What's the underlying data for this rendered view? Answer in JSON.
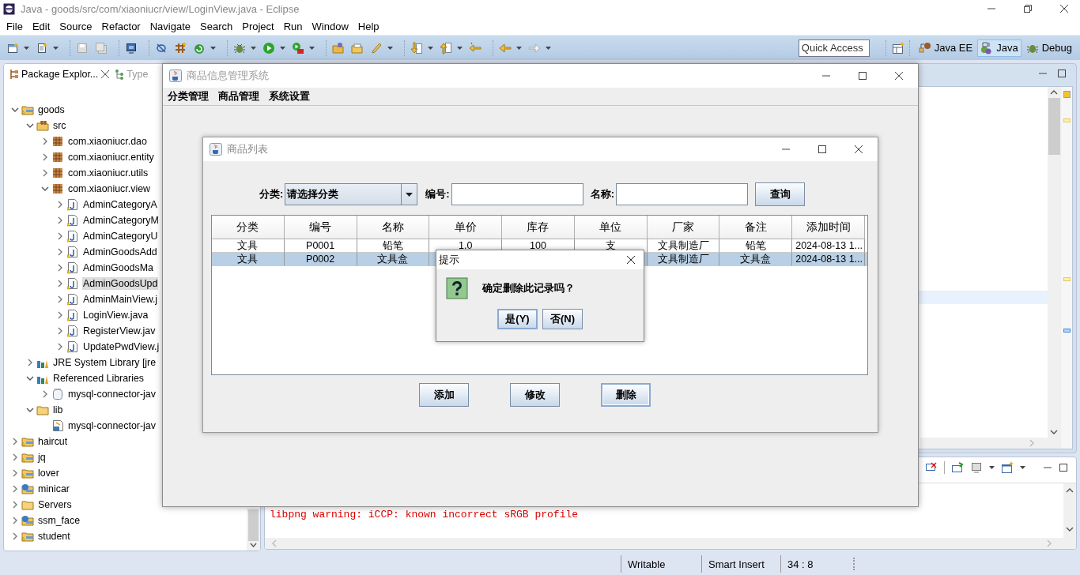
{
  "eclipse": {
    "title": "Java - goods/src/com/xiaoniucr/view/LoginView.java - Eclipse",
    "menu": [
      "File",
      "Edit",
      "Source",
      "Refactor",
      "Navigate",
      "Search",
      "Project",
      "Run",
      "Window",
      "Help"
    ],
    "quick_access": {
      "placeholder": "Quick Access"
    },
    "perspectives": [
      {
        "label": "Java EE",
        "selected": false
      },
      {
        "label": "Java",
        "selected": true
      },
      {
        "label": "Debug",
        "selected": false
      }
    ],
    "explorer": {
      "tabs": [
        {
          "label": "Package Explor...",
          "selected": true
        },
        {
          "label": "Type",
          "selected": false
        }
      ],
      "tree": [
        {
          "label": "goods",
          "kind": "project",
          "expanded": true,
          "selected": false,
          "children": [
            {
              "label": "src",
              "kind": "source",
              "expanded": true,
              "selected": false,
              "children": [
                {
                  "label": "com.xiaoniucr.dao",
                  "kind": "package",
                  "expanded": false,
                  "selected": false
                },
                {
                  "label": "com.xiaoniucr.entity",
                  "kind": "package",
                  "expanded": false,
                  "selected": false
                },
                {
                  "label": "com.xiaoniucr.utils",
                  "kind": "package",
                  "expanded": false,
                  "selected": false
                },
                {
                  "label": "com.xiaoniucr.view",
                  "kind": "package",
                  "expanded": true,
                  "selected": false,
                  "children": [
                    {
                      "label": "AdminCategoryA",
                      "kind": "java",
                      "expanded": false,
                      "selected": false
                    },
                    {
                      "label": "AdminCategoryM",
                      "kind": "java",
                      "expanded": false,
                      "selected": false
                    },
                    {
                      "label": "AdminCategoryU",
                      "kind": "java",
                      "expanded": false,
                      "selected": false
                    },
                    {
                      "label": "AdminGoodsAdd",
                      "kind": "java",
                      "expanded": false,
                      "selected": false
                    },
                    {
                      "label": "AdminGoodsMa",
                      "kind": "java",
                      "expanded": false,
                      "selected": false
                    },
                    {
                      "label": "AdminGoodsUpd",
                      "kind": "java",
                      "expanded": false,
                      "selected": true
                    },
                    {
                      "label": "AdminMainView.j",
                      "kind": "java",
                      "expanded": false,
                      "selected": false
                    },
                    {
                      "label": "LoginView.java",
                      "kind": "java",
                      "expanded": false,
                      "selected": false
                    },
                    {
                      "label": "RegisterView.jav",
                      "kind": "java",
                      "expanded": false,
                      "selected": false
                    },
                    {
                      "label": "UpdatePwdView.j",
                      "kind": "java",
                      "expanded": false,
                      "selected": false
                    }
                  ]
                }
              ]
            },
            {
              "label": "JRE System Library [jre",
              "kind": "library",
              "expanded": false,
              "selected": false
            },
            {
              "label": "Referenced Libraries",
              "kind": "library",
              "expanded": true,
              "selected": false,
              "children": [
                {
                  "label": "mysql-connector-jav",
                  "kind": "jar",
                  "expanded": false,
                  "selected": false
                }
              ]
            },
            {
              "label": "lib",
              "kind": "folder",
              "expanded": true,
              "selected": false,
              "children": [
                {
                  "label": "mysql-connector-jav",
                  "kind": "jarfile",
                  "selected": false
                }
              ]
            }
          ]
        },
        {
          "label": "haircut",
          "kind": "project",
          "expanded": false,
          "selected": false
        },
        {
          "label": "jq",
          "kind": "project",
          "expanded": false,
          "selected": false
        },
        {
          "label": "lover",
          "kind": "project",
          "expanded": false,
          "selected": false
        },
        {
          "label": "minicar",
          "kind": "webproject",
          "expanded": false,
          "selected": false
        },
        {
          "label": "Servers",
          "kind": "folder",
          "expanded": false,
          "selected": false
        },
        {
          "label": "ssm_face",
          "kind": "webproject",
          "expanded": false,
          "selected": false
        },
        {
          "label": "student",
          "kind": "project",
          "expanded": false,
          "selected": false
        }
      ]
    },
    "console": {
      "lines": [
        "libpng warning: iCCP: known incorrect sRGB profile"
      ]
    },
    "status_bar": [
      "Writable",
      "Smart Insert",
      "34 : 8"
    ]
  },
  "main_window": {
    "title": "商品信息管理系统",
    "menu": [
      "分类管理",
      "商品管理",
      "系统设置"
    ]
  },
  "list_window": {
    "title": "商品列表",
    "filters": [
      {
        "label": "分类:",
        "kind": "combo",
        "value": "请选择分类"
      },
      {
        "label": "编号:",
        "kind": "text"
      },
      {
        "label": "名称:",
        "kind": "text"
      }
    ],
    "search_button": "查询",
    "table": {
      "columns": [
        "分类",
        "编号",
        "名称",
        "单价",
        "库存",
        "单位",
        "厂家",
        "备注",
        "添加时间"
      ],
      "rows": [
        {
          "selected": false,
          "cells": [
            "文具",
            "P0001",
            "铅笔",
            "1.0",
            "100",
            "支",
            "文具制造厂",
            "铅笔",
            "2024-08-13 1..."
          ]
        },
        {
          "selected": true,
          "cells": [
            "文具",
            "P0002",
            "文具盒",
            null,
            null,
            null,
            "文具制造厂",
            "文具盒",
            "2024-08-13 1..."
          ]
        }
      ]
    },
    "buttons": [
      {
        "label": "添加",
        "focused": false
      },
      {
        "label": "修改",
        "focused": false
      },
      {
        "label": "删除",
        "focused": true
      }
    ]
  },
  "dialog": {
    "title": "提示",
    "message": "确定删除此记录吗？",
    "buttons": [
      {
        "label": "是(Y)",
        "focused": true
      },
      {
        "label": "否(N)",
        "focused": false
      }
    ]
  }
}
